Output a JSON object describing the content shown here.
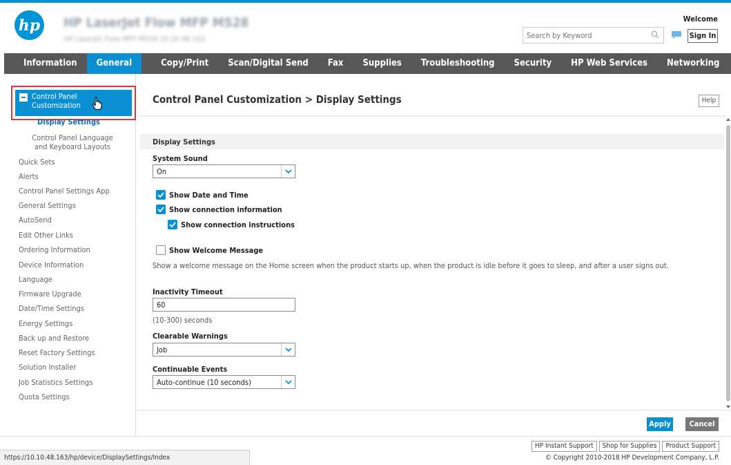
{
  "header": {
    "device_name": "HP LaserJet Flow MFP M528",
    "device_subtitle": "HP LaserJet Flow MFP M528  10.10.48.163",
    "search_placeholder": "Search by Keyword",
    "welcome": "Welcome",
    "signin": "Sign In",
    "logo_text": "hp"
  },
  "nav": {
    "tabs": [
      {
        "label": "Information"
      },
      {
        "label": "General"
      },
      {
        "label": "Copy/Print"
      },
      {
        "label": "Scan/Digital Send"
      },
      {
        "label": "Fax"
      },
      {
        "label": "Supplies"
      },
      {
        "label": "Troubleshooting"
      },
      {
        "label": "Security"
      },
      {
        "label": "HP Web Services"
      },
      {
        "label": "Networking"
      }
    ],
    "active": "General"
  },
  "sidebar": {
    "expanded_item": "Control Panel Customization",
    "subitems": [
      "Display Settings",
      "Control Panel Language and Keyboard Layouts"
    ],
    "subitem2_line1": "Control Panel Language",
    "subitem2_line2": "and Keyboard Layouts",
    "items": [
      "Quick Sets",
      "Alerts",
      "Control Panel Settings App",
      "General Settings",
      "AutoSend",
      "Edit Other Links",
      "Ordering Information",
      "Device Information",
      "Language",
      "Firmware Upgrade",
      "Date/Time Settings",
      "Energy Settings",
      "Back up and Restore",
      "Reset Factory Settings",
      "Solution Installer",
      "Job Statistics Settings",
      "Quota Settings"
    ],
    "cp_line1": "Control Panel",
    "cp_line2": "Customization"
  },
  "main": {
    "title": "Control Panel Customization > Display Settings",
    "help": "Help",
    "section": "Display Settings",
    "system_sound": {
      "label": "System Sound",
      "value": "On"
    },
    "checkboxes": {
      "date_time": {
        "label": "Show Date and Time",
        "checked": true
      },
      "connection_info": {
        "label": "Show connection information",
        "checked": true
      },
      "connection_instr": {
        "label": "Show connection instructions",
        "checked": true
      },
      "welcome_msg": {
        "label": "Show Welcome Message",
        "checked": false
      }
    },
    "welcome_desc": "Show a welcome message on the Home screen when the product starts up, when the product is idle before it goes to sleep, and after a user signs out.",
    "inactivity": {
      "label": "Inactivity Timeout",
      "value": "60",
      "hint": "(10-300) seconds"
    },
    "clearable": {
      "label": "Clearable Warnings",
      "value": "Job"
    },
    "continuable": {
      "label": "Continuable Events",
      "value": "Auto-continue (10 seconds)"
    },
    "apply": "Apply",
    "cancel": "Cancel"
  },
  "footer": {
    "links": [
      "HP Instant Support",
      "Shop for Supplies",
      "Product Support"
    ],
    "copyright": "© Copyright 2010-2018 HP Development Company, L.P."
  },
  "statusbar": {
    "url": "https://10.10.48.163/hp/device/DisplaySettings/Index"
  },
  "colors": {
    "accent": "#0b8fd3",
    "nav_bg": "#575757",
    "highlight_border": "#e0363a"
  }
}
